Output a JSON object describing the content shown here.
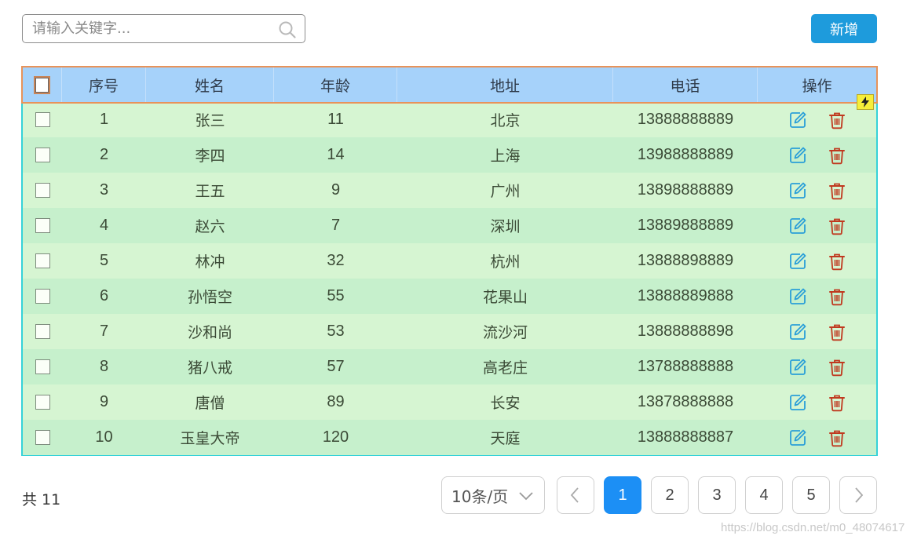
{
  "search": {
    "placeholder": "请输入关键字..."
  },
  "toolbar": {
    "add_label": "新增"
  },
  "table": {
    "headers": [
      "序号",
      "姓名",
      "年龄",
      "地址",
      "电话",
      "操作"
    ],
    "rows": [
      {
        "no": "1",
        "name": "张三",
        "age": "11",
        "addr": "北京",
        "tel": "13888888889"
      },
      {
        "no": "2",
        "name": "李四",
        "age": "14",
        "addr": "上海",
        "tel": "13988888889"
      },
      {
        "no": "3",
        "name": "王五",
        "age": "9",
        "addr": "广州",
        "tel": "13898888889"
      },
      {
        "no": "4",
        "name": "赵六",
        "age": "7",
        "addr": "深圳",
        "tel": "13889888889"
      },
      {
        "no": "5",
        "name": "林冲",
        "age": "32",
        "addr": "杭州",
        "tel": "13888898889"
      },
      {
        "no": "6",
        "name": "孙悟空",
        "age": "55",
        "addr": "花果山",
        "tel": "13888889888"
      },
      {
        "no": "7",
        "name": "沙和尚",
        "age": "53",
        "addr": "流沙河",
        "tel": "13888888898"
      },
      {
        "no": "8",
        "name": "猪八戒",
        "age": "57",
        "addr": "高老庄",
        "tel": "13788888888"
      },
      {
        "no": "9",
        "name": "唐僧",
        "age": "89",
        "addr": "长安",
        "tel": "13878888888"
      },
      {
        "no": "10",
        "name": "玉皇大帝",
        "age": "120",
        "addr": "天庭",
        "tel": "13888888887"
      }
    ]
  },
  "pagination": {
    "total_label": "共 11",
    "page_size_label": "10条/页",
    "pages": [
      "1",
      "2",
      "3",
      "4",
      "5"
    ],
    "current_page": "1"
  },
  "icons": {
    "search": "search-icon",
    "edit": "edit-icon",
    "delete": "trash-icon",
    "prev": "chevron-left-icon",
    "next": "chevron-right-icon",
    "dropdown": "chevron-down-icon",
    "flash": "lightning-icon"
  },
  "colors": {
    "accent": "#1e9bdc",
    "header_bg": "#a6d2fa",
    "row_odd": "#d6f5d2",
    "row_even": "#c6f0cc",
    "edit_icon": "#2a9fd8",
    "delete_icon": "#c0391f",
    "active_page": "#1c8ff5"
  },
  "watermark": "https://blog.csdn.net/m0_48074617"
}
